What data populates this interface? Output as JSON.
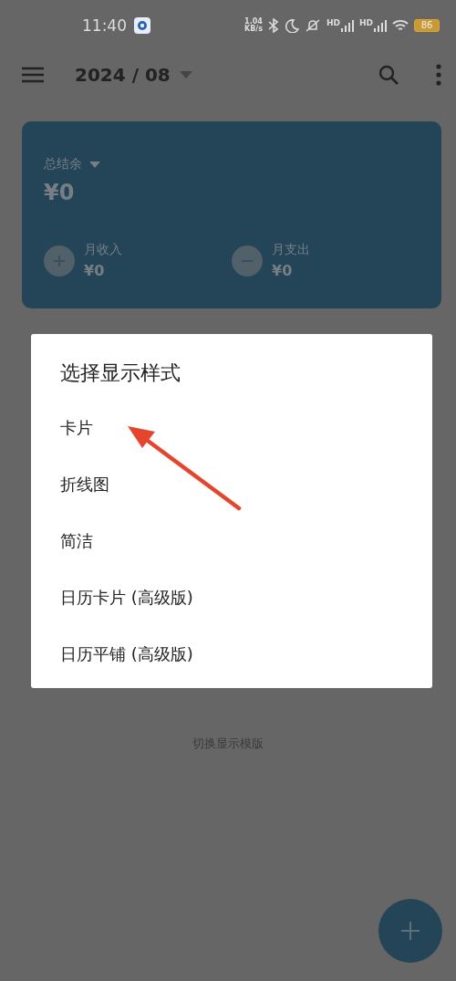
{
  "status_bar": {
    "time": "11:40",
    "net_speed_value": "1.04",
    "net_speed_unit": "KB/s",
    "signals": [
      {
        "label": "HD"
      },
      {
        "label": "HD"
      }
    ],
    "battery": "86"
  },
  "app_bar": {
    "title": "2024 / 08"
  },
  "summary_card": {
    "label": "总结余",
    "balance": "¥0",
    "income": {
      "label": "月收入",
      "value": "¥0"
    },
    "expense": {
      "label": "月支出",
      "value": "¥0"
    }
  },
  "switch_template_link": "切换显示模版",
  "dialog": {
    "title": "选择显示样式",
    "options": [
      {
        "label": "卡片"
      },
      {
        "label": "折线图"
      },
      {
        "label": "简洁"
      },
      {
        "label": "日历卡片 (高级版)"
      },
      {
        "label": "日历平铺 (高级版)"
      }
    ]
  },
  "annotation": {
    "kind": "arrow"
  }
}
